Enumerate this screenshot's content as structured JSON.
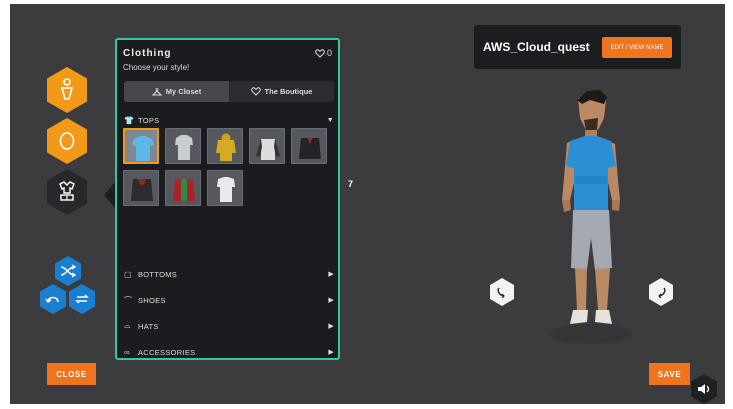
{
  "panel": {
    "title": "Clothing",
    "subtitle": "Choose your style!",
    "favorites_count": "0",
    "tabs": [
      {
        "label": "My Closet",
        "active": true
      },
      {
        "label": "The Boutique",
        "active": false
      }
    ],
    "categories": {
      "tops": "TOPS",
      "bottoms": "BOTTOMS",
      "shoes": "SHOES",
      "hats": "HATS",
      "accessories": "ACCESSORIES"
    }
  },
  "avatar": {
    "name": "AWS_Cloud_quest",
    "edit_label": "EDIT / VIEW NAME"
  },
  "buttons": {
    "close": "CLOSE",
    "save": "SAVE"
  },
  "counter": "7",
  "colors": {
    "accent_orange": "#f0731e",
    "hex_orange": "#f29a18",
    "panel_border": "#35c7a4",
    "blue_control": "#1b7fd1",
    "scene_bg": "#3c3c3f"
  },
  "icons": {
    "left_nav": [
      "body-icon",
      "head-icon",
      "clothing-icon"
    ],
    "controls": [
      "shuffle-icon",
      "undo-icon",
      "swap-icon"
    ]
  }
}
